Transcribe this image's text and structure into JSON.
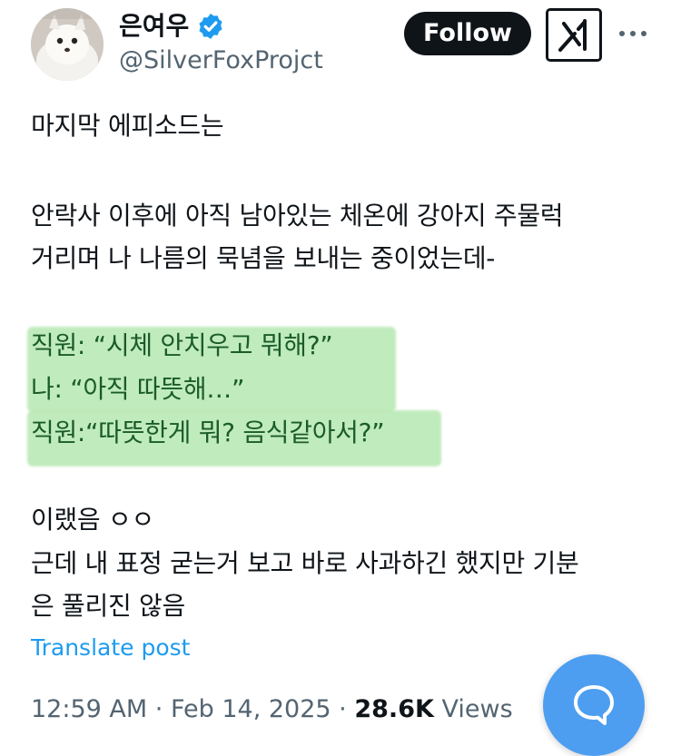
{
  "author": {
    "display_name": "은여우",
    "handle": "@SilverFoxProjct",
    "verified_icon": "verified-badge-icon",
    "avatar_icon": "white-fox-avatar"
  },
  "header": {
    "follow_label": "Follow",
    "grok_icon": "grok-icon",
    "more_icon": "more-dots-icon"
  },
  "tweet": {
    "lines": [
      "마지막 에피소드는",
      "안락사 이후에 아직 남아있는 체온에 강아지 주물럭",
      "거리며 나 나름의 묵념을 보내는 중이었는데-",
      "직원: “시체 안치우고 뭐해?”",
      "나: “아직 따뜻해…”",
      "직원:“따뜻한게 뭐? 음식같아서?”",
      "이랬음 ㅇㅇ",
      "근데 내 표정 굳는거 보고 바로 사과하긴 했지만 기분",
      "은 풀리진 않음"
    ],
    "highlight_color": "#b6e8b2"
  },
  "translate_label": "Translate post",
  "meta": {
    "time": "12:59 AM",
    "separator": "·",
    "date": "Feb 14, 2025",
    "views_count": "28.6K",
    "views_label": "Views"
  },
  "fab": {
    "icon": "compose-reply-icon",
    "color": "#4d9ef0"
  },
  "colors": {
    "text": "#0f1419",
    "secondary": "#536471",
    "link": "#1d9bf0"
  }
}
